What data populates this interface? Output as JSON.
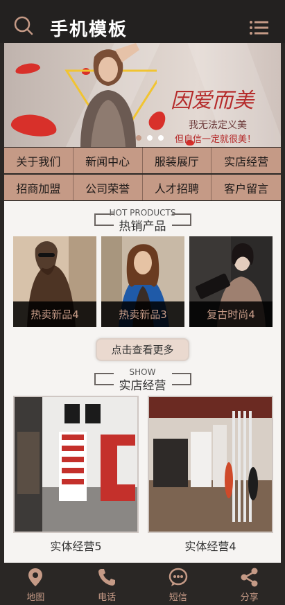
{
  "header": {
    "title": "手机模板",
    "search_icon": "search-icon",
    "menu_icon": "menu-icon"
  },
  "banner": {
    "headline": "因爱而美",
    "line1": "我无法定义美",
    "line2": "但自信一定就很美！",
    "slides": 3,
    "active_slide": 2
  },
  "nav": {
    "items": [
      "关于我们",
      "新闻中心",
      "服装展厅",
      "实店经营",
      "招商加盟",
      "公司荣誉",
      "人才招聘",
      "客户留言"
    ]
  },
  "hot": {
    "en": "HOT PRODUCTS",
    "cn": "热销产品",
    "products": [
      {
        "label": "热卖新品4"
      },
      {
        "label": "热卖新品3"
      },
      {
        "label": "复古时尚4"
      }
    ],
    "more_label": "点击查看更多"
  },
  "show": {
    "en": "SHOW",
    "cn": "实店经营",
    "stores": [
      {
        "label": "实体经营5"
      },
      {
        "label": "实体经营4"
      }
    ]
  },
  "footer": {
    "items": [
      {
        "label": "地图",
        "icon": "map-pin-icon"
      },
      {
        "label": "电话",
        "icon": "phone-icon"
      },
      {
        "label": "短信",
        "icon": "message-icon"
      },
      {
        "label": "分享",
        "icon": "share-icon"
      }
    ]
  },
  "colors": {
    "accent": "#c59a86",
    "dark": "#232120",
    "light": "#f6f4f2"
  }
}
